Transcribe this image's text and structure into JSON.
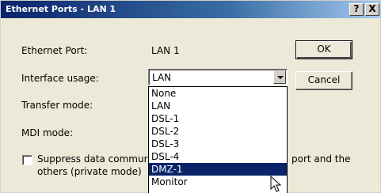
{
  "window": {
    "title": "Ethernet Ports - LAN 1",
    "help_label": "?",
    "close_label": "X"
  },
  "form": {
    "port_label": "Ethernet Port:",
    "port_value": "LAN 1",
    "usage_label": "Interface usage:",
    "usage_value": "LAN",
    "transfer_label": "Transfer mode:",
    "mdi_label": "MDI mode:"
  },
  "buttons": {
    "ok_label": "OK",
    "cancel_label": "Cancel"
  },
  "checkbox": {
    "label_line1_start": "Suppress data commur",
    "label_line1_end": "port and the",
    "label_line2": "others (private mode)",
    "checked": false
  },
  "dropdown": {
    "items": [
      "None",
      "LAN",
      "DSL-1",
      "DSL-2",
      "DSL-3",
      "DSL-4",
      "DMZ-1",
      "Monitor"
    ],
    "highlighted": "DMZ-1"
  },
  "colors": {
    "titlebar_start": "#0a246a",
    "titlebar_end": "#a6caf0",
    "selection": "#0a246a",
    "dialog_bg": "#ece9d8"
  }
}
